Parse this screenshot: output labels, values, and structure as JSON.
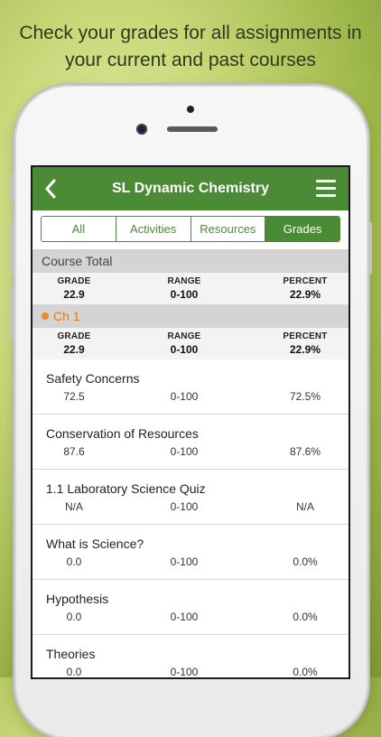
{
  "tagline": {
    "line1": "Check your grades for all assignments in",
    "line2": "your current and past courses"
  },
  "navbar": {
    "title": "SL Dynamic Chemistry",
    "back_icon": "chevron-left-icon",
    "menu_icon": "hamburger-menu-icon"
  },
  "tabs": [
    {
      "label": "All",
      "active": false
    },
    {
      "label": "Activities",
      "active": false
    },
    {
      "label": "Resources",
      "active": false
    },
    {
      "label": "Grades",
      "active": true
    }
  ],
  "colors": {
    "brand_green": "#4b8b36",
    "chapter_orange": "#e07a16"
  },
  "course_total": {
    "title": "Course Total",
    "grade_label": "GRADE",
    "grade": "22.9",
    "range_label": "RANGE",
    "range": "0-100",
    "percent_label": "PERCENT",
    "percent": "22.9%"
  },
  "chapter": {
    "title": "Ch 1",
    "grade_label": "GRADE",
    "grade": "22.9",
    "range_label": "RANGE",
    "range": "0-100",
    "percent_label": "PERCENT",
    "percent": "22.9%"
  },
  "items": [
    {
      "name": "Safety Concerns",
      "grade": "72.5",
      "range": "0-100",
      "percent": "72.5%"
    },
    {
      "name": "Conservation of Resources",
      "grade": "87.6",
      "range": "0-100",
      "percent": "87.6%"
    },
    {
      "name": "1.1 Laboratory Science Quiz",
      "grade": "N/A",
      "range": "0-100",
      "percent": "N/A"
    },
    {
      "name": "What is Science?",
      "grade": "0.0",
      "range": "0-100",
      "percent": "0.0%"
    },
    {
      "name": "Hypothesis",
      "grade": "0.0",
      "range": "0-100",
      "percent": "0.0%"
    },
    {
      "name": "Theories",
      "grade": "0.0",
      "range": "0-100",
      "percent": "0.0%"
    }
  ]
}
